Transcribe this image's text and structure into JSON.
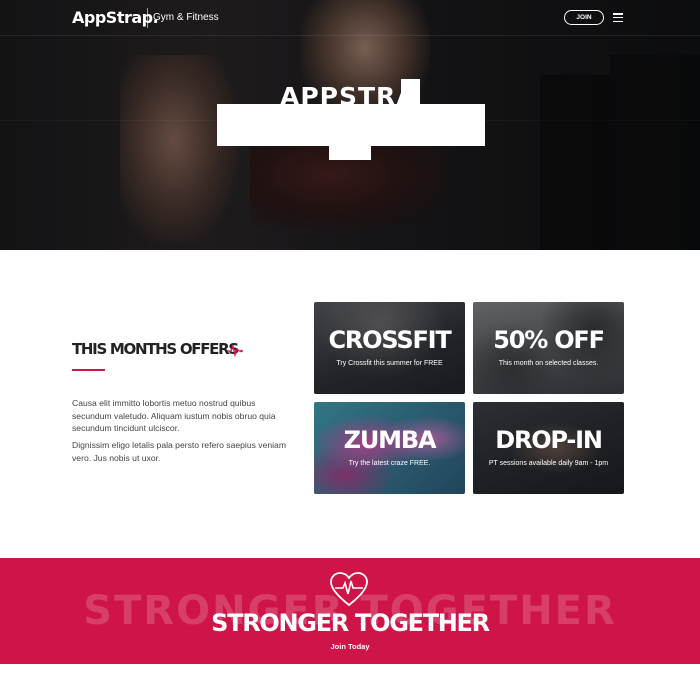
{
  "nav": {
    "logo": "AppStrap.",
    "tagline": "Gym & Fitness",
    "join_label": "JOIN",
    "menu_icon": "hamburger-icon"
  },
  "hero": {
    "title": "APPSTRA"
  },
  "offers": {
    "title": "THIS MONTHS OFFERS",
    "title_icon": "heartbeat-pulse-icon",
    "accent_color": "#d2164c",
    "paragraph_1": "Causa elit immitto lobortis metuo nostrud quibus secundum valetudo. Aliquam iustum nobis obruo quia secundum tincidunt ulciscor.",
    "paragraph_2": "Dignissim eligo letalis pala persto refero saepius veniam vero. Jus nobis ut uxor.",
    "tiles": [
      {
        "title": "CROSSFIT",
        "subtitle": "Try Crossfit this summer for FREE"
      },
      {
        "title": "50% OFF",
        "subtitle": "This month on selected classes."
      },
      {
        "title": "ZUMBA",
        "subtitle": "Try the latest craze FREE."
      },
      {
        "title": "DROP-IN",
        "subtitle": "PT sessions available daily 9am - 1pm"
      }
    ]
  },
  "banner": {
    "ghost_text": "STRONGER TOGETHER",
    "title": "STRONGER TOGETHER",
    "link": "Join Today",
    "icon": "heart-pulse-icon",
    "background_color": "#cf1548"
  }
}
